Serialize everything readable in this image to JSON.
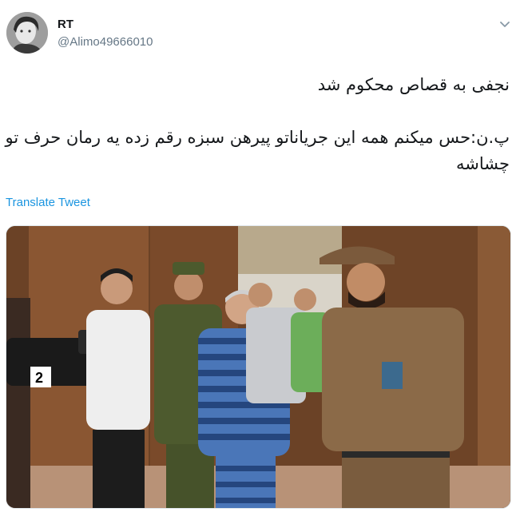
{
  "author": {
    "display_name": "RT",
    "handle": "@Alimo49666010",
    "avatar_icon": "avatar-photo"
  },
  "menu": {
    "caret_icon": "chevron-down-icon"
  },
  "tweet": {
    "lines": [
      "نجفی به قصاص محکوم شد",
      "پ.ن:حس میکنم همه این جریاناتو پیرهن سبزه رقم زده یه رمان حرف تو چشاشه"
    ]
  },
  "translate_link": "Translate Tweet",
  "media": {
    "camera_badge": "2"
  },
  "colors": {
    "link": "#1b95e0",
    "secondary": "#657786",
    "text": "#14171a"
  }
}
